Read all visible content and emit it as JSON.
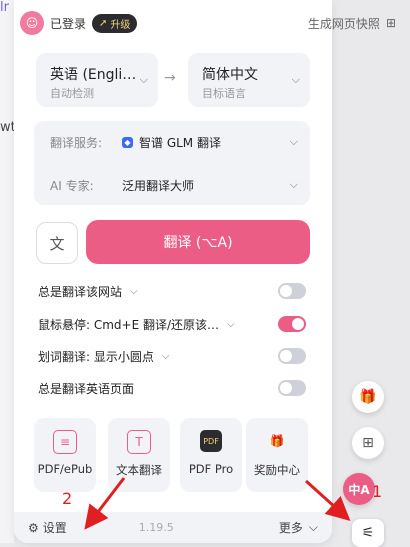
{
  "header": {
    "login_text": "已登录",
    "upgrade_label": "升级",
    "snapshot_label": "生成网页快照"
  },
  "languages": {
    "source": {
      "name": "英语 (Engli…",
      "sub": "自动检测"
    },
    "target": {
      "name": "简体中文",
      "sub": "目标语言"
    }
  },
  "service": {
    "label": "翻译服务:",
    "value": "智谱 GLM 翻译"
  },
  "expert": {
    "label": "AI 专家:",
    "value": "泛用翻译大师"
  },
  "translate_button": "翻译 (⌥A)",
  "options": [
    {
      "label": "总是翻译该网站",
      "on": false
    },
    {
      "label": "鼠标悬停: Cmd+E 翻译/还原该…",
      "on": true
    },
    {
      "label": "划词翻译: 显示小圆点",
      "on": false
    },
    {
      "label": "总是翻译英语页面",
      "on": false
    }
  ],
  "tiles": [
    {
      "label": "PDF/ePub",
      "icon": "document-icon"
    },
    {
      "label": "文本翻译",
      "icon": "text-icon"
    },
    {
      "label": "PDF Pro",
      "icon": "pdf-icon"
    },
    {
      "label": "奖励中心",
      "icon": "gift-icon"
    }
  ],
  "footer": {
    "settings": "设置",
    "version": "1.19.5",
    "more": "更多"
  },
  "annotations": {
    "one": "1",
    "two": "2"
  },
  "colors": {
    "accent": "#ec5d86",
    "arrow": "#e02020"
  }
}
